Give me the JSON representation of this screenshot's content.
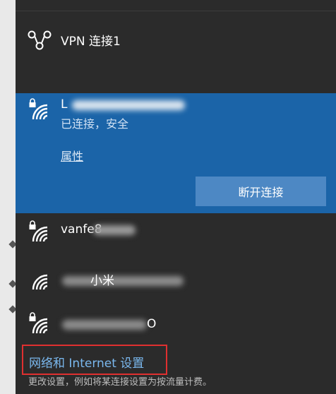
{
  "vpn": {
    "label": "VPN 连接1",
    "icon": "vpn-icon"
  },
  "connected_network": {
    "ssid": "L",
    "status": "已连接，安全",
    "properties_label": "属性",
    "disconnect_label": "断开连接",
    "icon": "wifi-icon",
    "secured": true
  },
  "networks": [
    {
      "ssid": "vanfe8",
      "secured": true,
      "icon": "wifi-icon"
    },
    {
      "ssid": "小米",
      "secured": false,
      "icon": "wifi-icon"
    },
    {
      "ssid": "O",
      "secured": true,
      "icon": "wifi-icon"
    }
  ],
  "settings": {
    "link_label": "网络和 Internet 设置",
    "description": "更改设置，例如将某连接设置为按流量计费。"
  },
  "colors": {
    "panel_bg": "#2b2b2b",
    "selected_bg": "#1b64a8",
    "button_bg": "#4d88c4",
    "link": "#7ab8ee",
    "highlight_border": "#e03030"
  }
}
